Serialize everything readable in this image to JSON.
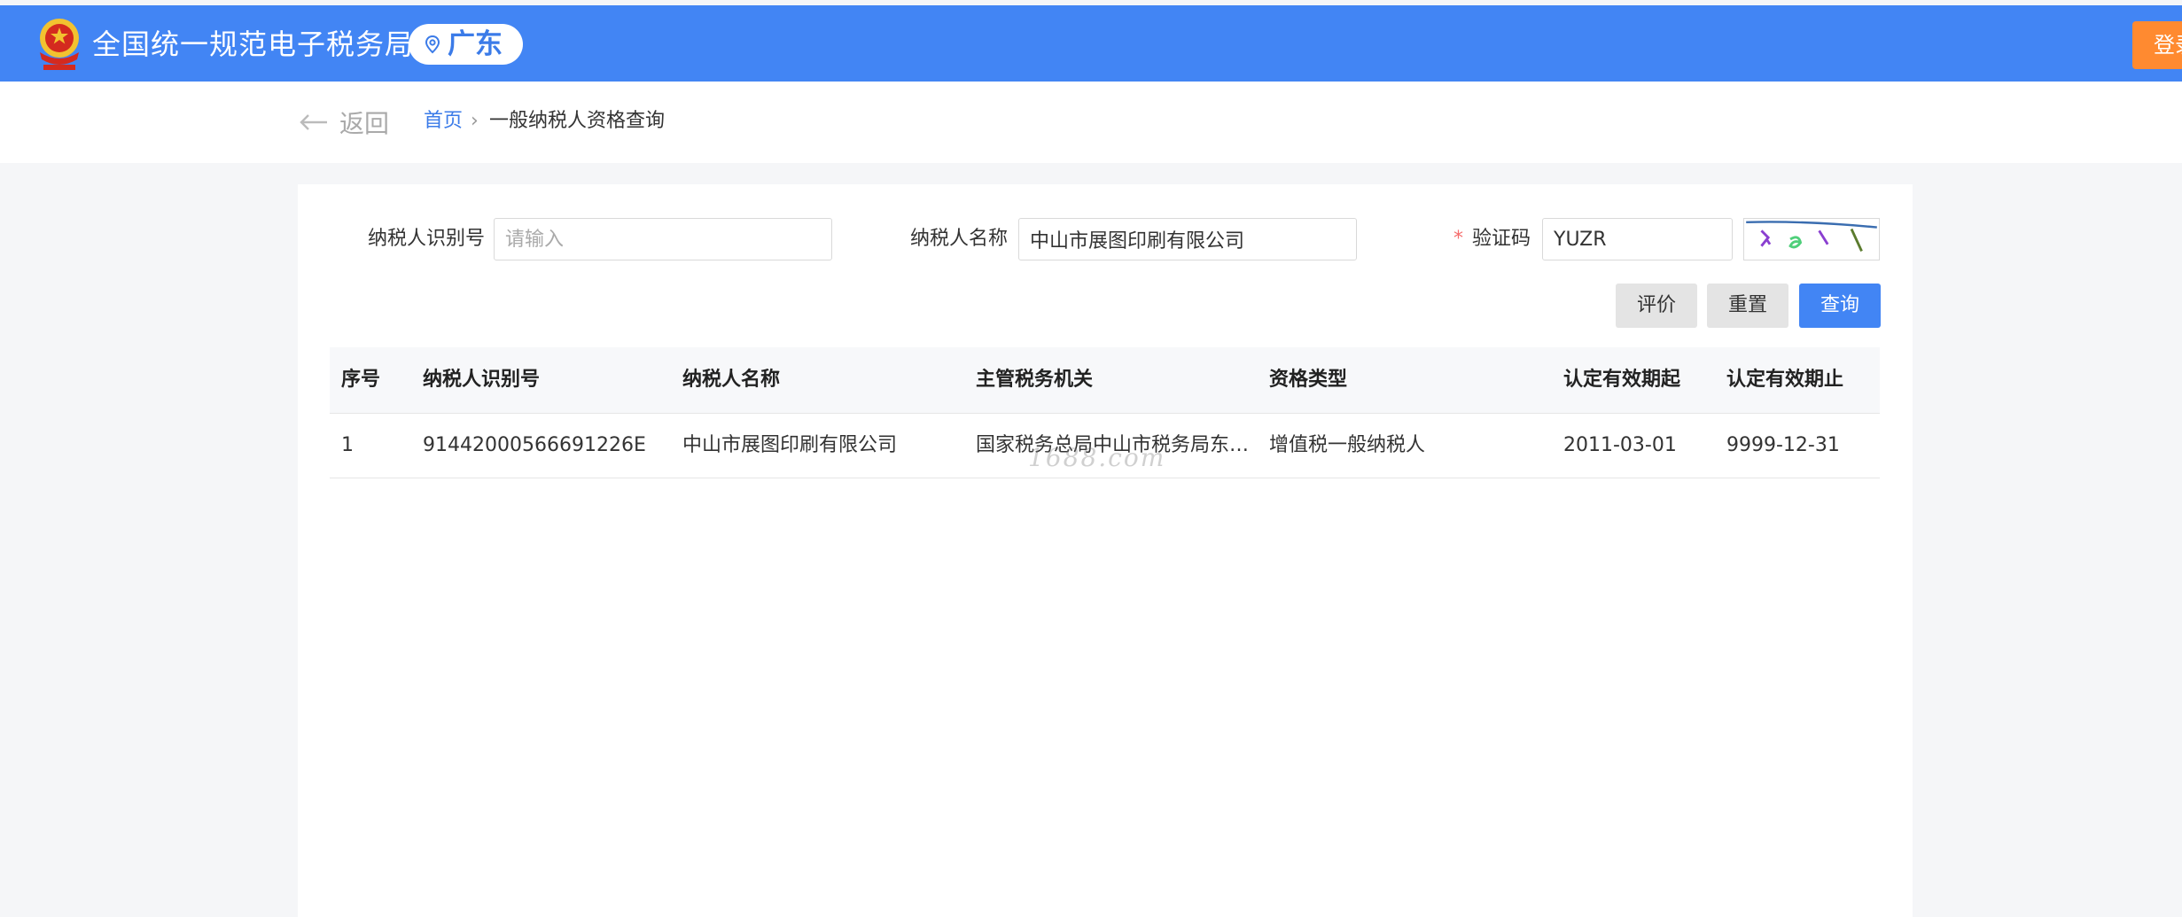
{
  "header": {
    "title": "全国统一规范电子税务局",
    "region": "广东",
    "login_label": "登录",
    "brand_color": "#4285f4",
    "login_color": "#ff8a30"
  },
  "nav": {
    "back_label": "返回",
    "breadcrumb": {
      "home": "首页",
      "separator": "›",
      "current": "一般纳税人资格查询"
    }
  },
  "form": {
    "taxpayer_id": {
      "label": "纳税人识别号",
      "value": "",
      "placeholder": "请输入"
    },
    "taxpayer_name": {
      "label": "纳税人名称",
      "value": "中山市展图印刷有限公司",
      "placeholder": ""
    },
    "captcha": {
      "required_mark": "*",
      "label": "验证码",
      "value": "YUZR",
      "placeholder": ""
    }
  },
  "buttons": {
    "evaluate": "评价",
    "reset": "重置",
    "query": "查询"
  },
  "table": {
    "headers": [
      "序号",
      "纳税人识别号",
      "纳税人名称",
      "主管税务机关",
      "资格类型",
      "认定有效期起",
      "认定有效期止"
    ],
    "rows": [
      [
        "1",
        "91442000566691226E",
        "中山市展图印刷有限公司",
        "国家税务总局中山市税务局东…",
        "增值税一般纳税人",
        "2011-03-01",
        "9999-12-31"
      ]
    ]
  },
  "watermark": "1688.com"
}
